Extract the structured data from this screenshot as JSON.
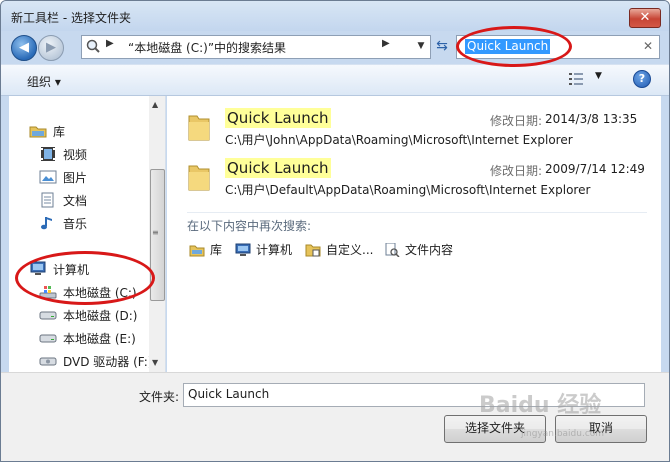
{
  "window": {
    "title": "新工具栏 - 选择文件夹",
    "close_glyph": "✕"
  },
  "nav": {
    "back_glyph": "◀",
    "forward_glyph": "▶",
    "address_text": "“本地磁盘 (C:)”中的搜索结果",
    "address_arrow": "▶",
    "dropdown_glyph": "▼",
    "refresh_glyph": "⇆",
    "search_value": "Quick Launch",
    "search_clear_glyph": "✕"
  },
  "toolbar": {
    "organize_label": "组织 ▾",
    "views_dropdown_glyph": "▼",
    "help_glyph": "?"
  },
  "sidebar": {
    "items": [
      {
        "label": "库",
        "icon": "library-icon"
      },
      {
        "label": "视频",
        "icon": "video-icon"
      },
      {
        "label": "图片",
        "icon": "picture-icon"
      },
      {
        "label": "文档",
        "icon": "document-icon"
      },
      {
        "label": "音乐",
        "icon": "music-icon"
      },
      {
        "label": "计算机",
        "icon": "computer-icon"
      },
      {
        "label": "本地磁盘 (C:)",
        "icon": "system-drive-icon"
      },
      {
        "label": "本地磁盘 (D:)",
        "icon": "drive-icon"
      },
      {
        "label": "本地磁盘 (E:)",
        "icon": "drive-icon"
      },
      {
        "label": "DVD 驱动器 (F:)",
        "icon": "dvd-drive-icon"
      }
    ],
    "scroll_up": "▲",
    "scroll_down": "▼",
    "scroll_grip": "≡"
  },
  "results": [
    {
      "name": "Quick Launch",
      "path": "C:\\用户\\John\\AppData\\Roaming\\Microsoft\\Internet Explorer",
      "date_label": "修改日期:",
      "date": "2014/3/8 13:35"
    },
    {
      "name": "Quick Launch",
      "path": "C:\\用户\\Default\\AppData\\Roaming\\Microsoft\\Internet Explorer",
      "date_label": "修改日期:",
      "date": "2009/7/14 12:49"
    }
  ],
  "search_again": {
    "label": "在以下内容中再次搜索:",
    "locations": [
      {
        "label": "库",
        "icon": "library-icon"
      },
      {
        "label": "计算机",
        "icon": "computer-icon"
      },
      {
        "label": "自定义...",
        "icon": "custom-folder-icon"
      },
      {
        "label": "文件内容",
        "icon": "file-content-icon"
      }
    ]
  },
  "bottom": {
    "folder_label": "文件夹:",
    "folder_value": "Quick Launch",
    "select_button": "选择文件夹",
    "cancel_button": "取消"
  },
  "watermark": {
    "text": "Baidu 经验",
    "sub": "jingyan.baidu.com"
  },
  "colors": {
    "highlight": "#ffff99",
    "selection": "#3399ff",
    "annotation": "#d81818"
  }
}
